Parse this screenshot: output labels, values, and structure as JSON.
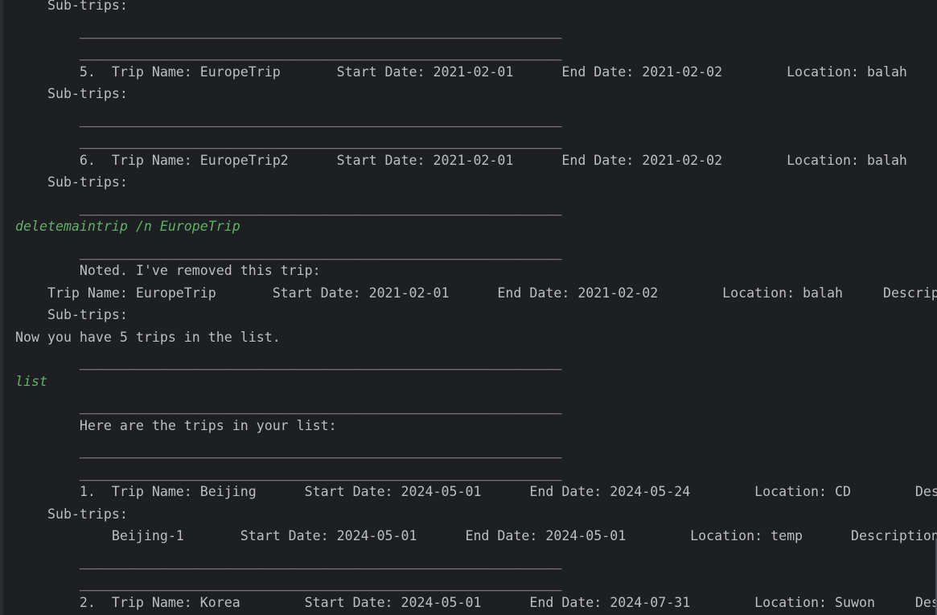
{
  "console": {
    "lines": [
      {
        "text": "    Sub-trips:",
        "kind": "out"
      },
      {
        "text": "        ____________________________________________________________",
        "kind": "out"
      },
      {
        "text": "        ____________________________________________________________",
        "kind": "out"
      },
      {
        "text": "        5.  Trip Name: EuropeTrip       Start Date: 2021-02-01      End Date: 2021-02-02        Location: balah",
        "kind": "out"
      },
      {
        "text": "    Sub-trips:",
        "kind": "out"
      },
      {
        "text": "        ____________________________________________________________",
        "kind": "out"
      },
      {
        "text": "        ____________________________________________________________",
        "kind": "out"
      },
      {
        "text": "        6.  Trip Name: EuropeTrip2      Start Date: 2021-02-01      End Date: 2021-02-02        Location: balah",
        "kind": "out"
      },
      {
        "text": "    Sub-trips:",
        "kind": "out"
      },
      {
        "text": "        ____________________________________________________________",
        "kind": "out"
      },
      {
        "text": "deletemaintrip /n EuropeTrip",
        "kind": "cmd"
      },
      {
        "text": "        ____________________________________________________________",
        "kind": "out"
      },
      {
        "text": "        Noted. I've removed this trip:",
        "kind": "out"
      },
      {
        "text": "    Trip Name: EuropeTrip       Start Date: 2021-02-01      End Date: 2021-02-02        Location: balah     Descrip",
        "kind": "out"
      },
      {
        "text": "    Sub-trips:",
        "kind": "out"
      },
      {
        "text": "Now you have 5 trips in the list.",
        "kind": "out"
      },
      {
        "text": "        ____________________________________________________________",
        "kind": "out"
      },
      {
        "text": "list",
        "kind": "cmd"
      },
      {
        "text": "        ____________________________________________________________",
        "kind": "out"
      },
      {
        "text": "        Here are the trips in your list:",
        "kind": "out"
      },
      {
        "text": "        ____________________________________________________________",
        "kind": "out"
      },
      {
        "text": "        ____________________________________________________________",
        "kind": "out"
      },
      {
        "text": "        1.  Trip Name: Beijing      Start Date: 2024-05-01      End Date: 2024-05-24        Location: CD        Des",
        "kind": "out"
      },
      {
        "text": "    Sub-trips:",
        "kind": "out"
      },
      {
        "text": "            Beijing-1       Start Date: 2024-05-01      End Date: 2024-05-01        Location: temp      Description",
        "kind": "out"
      },
      {
        "text": "        ____________________________________________________________",
        "kind": "out"
      },
      {
        "text": "        ____________________________________________________________",
        "kind": "out"
      },
      {
        "text": "        2.  Trip Name: Korea        Start Date: 2024-05-01      End Date: 2024-07-31        Location: Suwon     Des",
        "kind": "out"
      }
    ]
  }
}
